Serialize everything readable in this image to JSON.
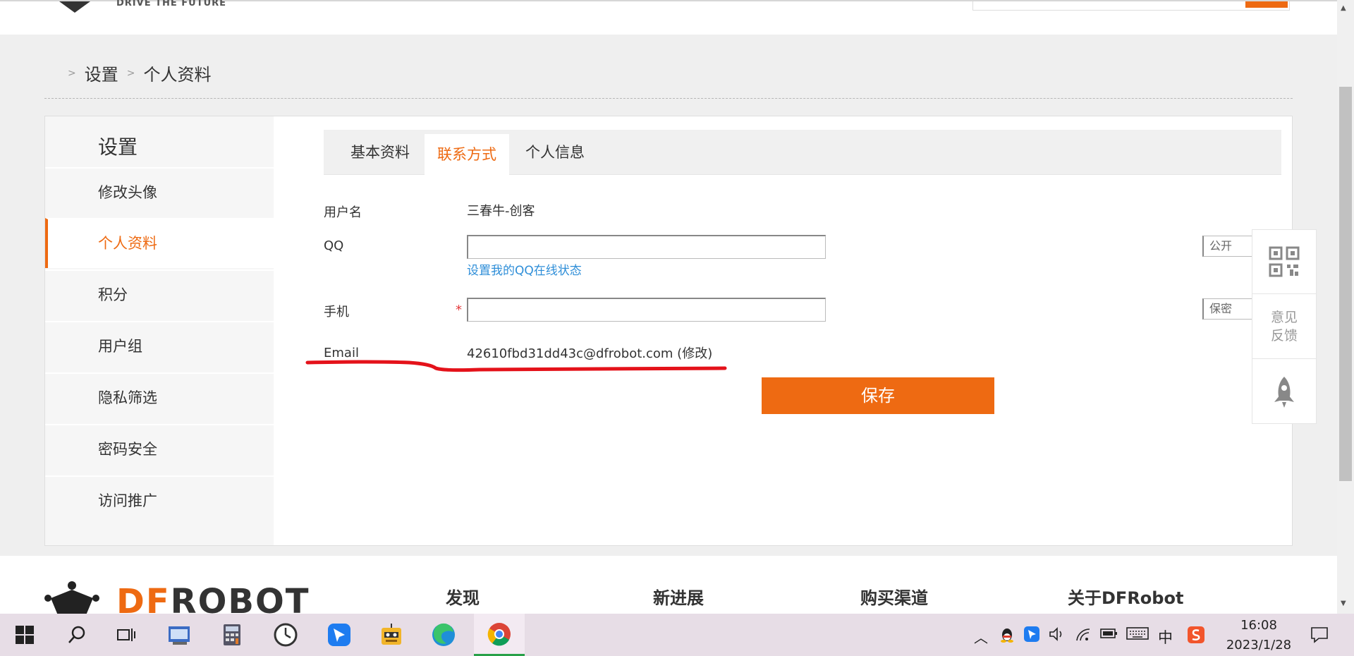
{
  "header": {
    "tagline": "DRIVE THE FUTURE"
  },
  "breadcrumb": {
    "sep": ">",
    "items": [
      "设置",
      "个人资料"
    ]
  },
  "sidebar": {
    "title": "设置",
    "items": [
      {
        "label": "修改头像"
      },
      {
        "label": "个人资料",
        "active": true
      },
      {
        "label": "积分"
      },
      {
        "label": "用户组"
      },
      {
        "label": "隐私筛选"
      },
      {
        "label": "密码安全"
      },
      {
        "label": "访问推广"
      }
    ]
  },
  "tabs": [
    {
      "label": "基本资料"
    },
    {
      "label": "联系方式",
      "active": true
    },
    {
      "label": "个人信息"
    }
  ],
  "form": {
    "username_label": "用户名",
    "username_value": "三春牛-创客",
    "qq_label": "QQ",
    "qq_value": "",
    "qq_link": "设置我的QQ在线状态",
    "qq_privacy": "公开",
    "phone_label": "手机",
    "phone_required": "*",
    "phone_value": "",
    "phone_privacy": "保密",
    "email_label": "Email",
    "email_value": "42610fbd31dd43c@dfrobot.com (修改)",
    "save_label": "保存"
  },
  "float_tools": {
    "feedback_line1": "意见",
    "feedback_line2": "反馈"
  },
  "footer": {
    "brand_a": "DF",
    "brand_b": "ROBOT",
    "col1": "发现",
    "col2": "新进展",
    "col3": "购买渠道",
    "col4": "关于DFRobot"
  },
  "taskbar": {
    "time": "16:08",
    "date": "2023/1/28",
    "ime": "中",
    "icons": [
      "windows-start",
      "search",
      "task-view",
      "app",
      "calculator",
      "clock-app",
      "feishu",
      "robot-app",
      "edge",
      "chrome"
    ]
  },
  "colors": {
    "accent": "#ee6a12",
    "link": "#2e8ed8",
    "annotation": "#e4121a"
  }
}
